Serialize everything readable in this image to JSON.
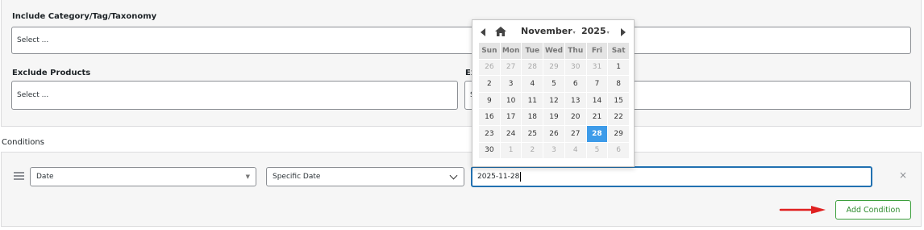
{
  "top_section": {
    "include_category_label": "Include Category/Tag/Taxonomy",
    "include_category_placeholder": "Select ...",
    "exclude_products_label": "Exclude Products",
    "exclude_products_placeholder": "Select ...",
    "second_label_fragment": "Ex",
    "second_select_fragment": "S"
  },
  "conditions": {
    "title": "Conditions",
    "type_select": "Date",
    "operator_select": "Specific Date",
    "date_value": "2025-11-28",
    "remove_icon": "×",
    "add_button": "Add Condition"
  },
  "calendar": {
    "month": "November",
    "year": "2025",
    "weekdays": [
      "Sun",
      "Mon",
      "Tue",
      "Wed",
      "Thu",
      "Fri",
      "Sat"
    ],
    "weeks": [
      [
        "26",
        "27",
        "28",
        "29",
        "30",
        "31",
        "1"
      ],
      [
        "2",
        "3",
        "4",
        "5",
        "6",
        "7",
        "8"
      ],
      [
        "9",
        "10",
        "11",
        "12",
        "13",
        "14",
        "15"
      ],
      [
        "16",
        "17",
        "18",
        "19",
        "20",
        "21",
        "22"
      ],
      [
        "23",
        "24",
        "25",
        "26",
        "27",
        "28",
        "29"
      ],
      [
        "30",
        "1",
        "2",
        "3",
        "4",
        "5",
        "6"
      ]
    ],
    "selected_day": "28",
    "icons": [
      "prev-month-icon",
      "home-icon",
      "next-month-icon"
    ]
  },
  "colors": {
    "accent": "#2271b1",
    "selected_day": "#3d9be9",
    "add_button": "#3c9f3c",
    "arrow": "#e02020"
  }
}
